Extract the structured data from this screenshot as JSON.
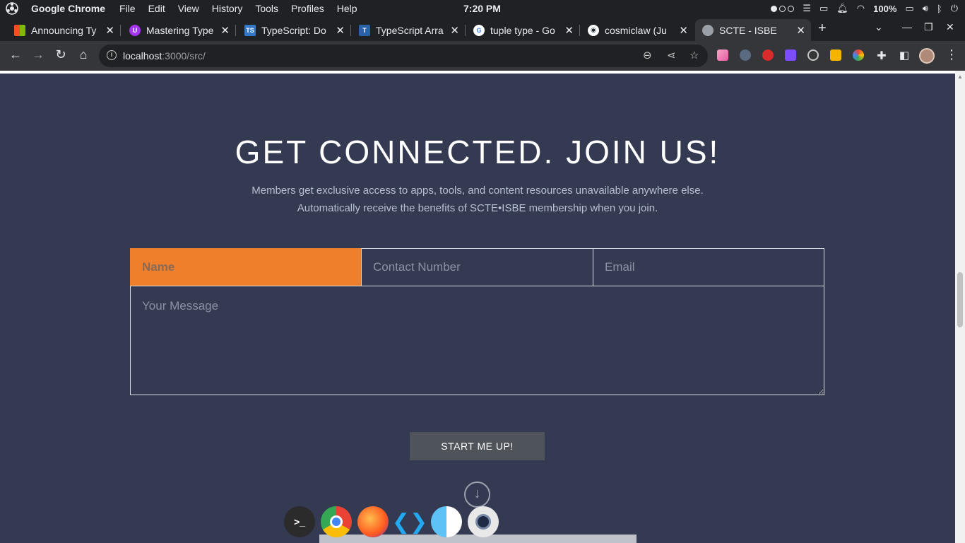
{
  "os": {
    "app_name": "Google Chrome",
    "menu": [
      "File",
      "Edit",
      "View",
      "History",
      "Tools",
      "Profiles",
      "Help"
    ],
    "clock": "7:20 PM",
    "battery": "100%"
  },
  "tabs": [
    {
      "title": "Announcing Ty",
      "favicon": "microsoft-icon"
    },
    {
      "title": "Mastering Type",
      "favicon": "udemy-icon"
    },
    {
      "title": "TypeScript: Do",
      "favicon": "typescript-icon"
    },
    {
      "title": "TypeScript Arra",
      "favicon": "tutorialsteacher-icon"
    },
    {
      "title": "tuple type - Go",
      "favicon": "google-icon"
    },
    {
      "title": "cosmiclaw (Ju",
      "favicon": "github-icon"
    },
    {
      "title": "SCTE - ISBE",
      "favicon": "globe-icon",
      "active": true
    }
  ],
  "address_bar": {
    "host": "localhost",
    "path": ":3000/src/"
  },
  "page": {
    "headline": "GET CONNECTED. JOIN US!",
    "subtext_line1": "Members get exclusive access to apps, tools, and content resources unavailable anywhere else.",
    "subtext_line2": "Automatically receive the benefits of SCTE•ISBE membership when you join.",
    "form": {
      "name_placeholder": "Name",
      "contact_placeholder": "Contact Number",
      "email_placeholder": "Email",
      "message_placeholder": "Your Message",
      "submit_label": "START ME UP!"
    }
  },
  "colors": {
    "page_bg": "#333a52",
    "accent_orange": "#f07f2b",
    "button_bg": "#4f535a"
  }
}
